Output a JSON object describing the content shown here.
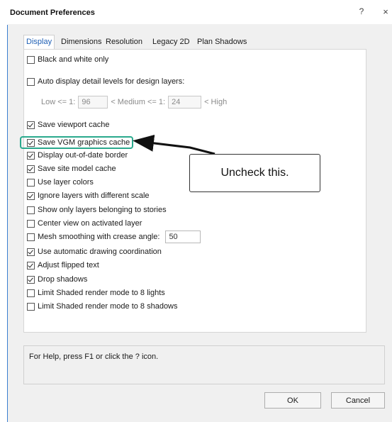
{
  "window": {
    "title": "Document Preferences",
    "help_glyph": "?",
    "close_glyph": "×"
  },
  "tabs": [
    {
      "label": "Display",
      "active": true
    },
    {
      "label": "Dimensions",
      "active": false
    },
    {
      "label": "Resolution",
      "active": false
    },
    {
      "label": "Legacy 2D",
      "active": false
    },
    {
      "label": "Plan Shadows",
      "active": false
    }
  ],
  "options": {
    "black_white": {
      "label": "Black and white only",
      "checked": false
    },
    "auto_detail": {
      "label": "Auto display detail levels for design layers:",
      "checked": false
    },
    "save_viewport": {
      "label": "Save viewport cache",
      "checked": true
    },
    "save_vgm": {
      "label": "Save VGM graphics cache",
      "checked": true
    },
    "out_of_date": {
      "label": "Display out-of-date border",
      "checked": true
    },
    "site_model": {
      "label": "Save site model cache",
      "checked": true
    },
    "layer_colors": {
      "label": "Use layer colors",
      "checked": false
    },
    "ignore_scale": {
      "label": "Ignore layers with different scale",
      "checked": true
    },
    "only_stories": {
      "label": "Show only layers belonging to stories",
      "checked": false
    },
    "center_view": {
      "label": "Center view on activated layer",
      "checked": false
    },
    "mesh_smoothing": {
      "label": "Mesh smoothing with crease angle:",
      "checked": false,
      "value": "50"
    },
    "auto_coord": {
      "label": "Use automatic drawing coordination",
      "checked": true
    },
    "flipped_text": {
      "label": "Adjust flipped text",
      "checked": true
    },
    "drop_shadows": {
      "label": "Drop shadows",
      "checked": true
    },
    "limit_lights": {
      "label": "Limit Shaded render mode to 8 lights",
      "checked": false
    },
    "limit_shadows": {
      "label": "Limit Shaded render mode to 8 shadows",
      "checked": false
    }
  },
  "detail_levels": {
    "low_label": "Low <= 1:",
    "low_value": "96",
    "medium_label": "< Medium <= 1:",
    "medium_value": "24",
    "high_label": "< High"
  },
  "annotation": {
    "callout_text": "Uncheck this.",
    "highlight_color": "#2aa98d"
  },
  "help_text": "For Help, press F1 or click the ? icon.",
  "buttons": {
    "ok": "OK",
    "cancel": "Cancel"
  },
  "colors": {
    "active_tab_text": "#1e5fb4",
    "window_edge": "#3b7fd0"
  }
}
